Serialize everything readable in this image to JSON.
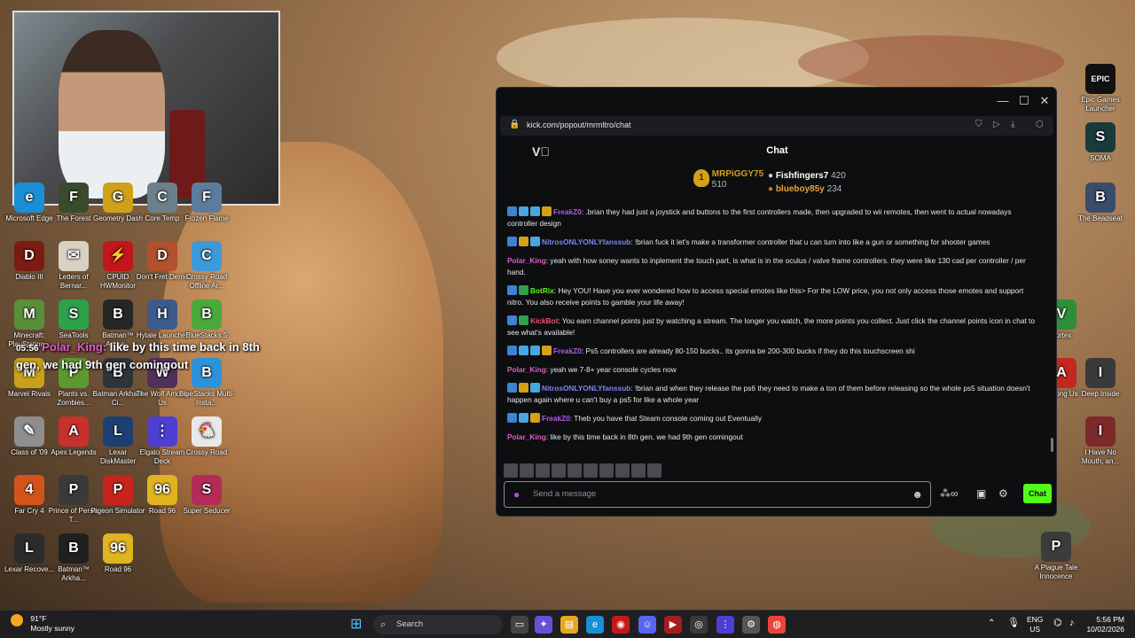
{
  "overlay": {
    "time": "05:56",
    "user": "Polar_King:",
    "text": "like by this time back in 8th gen, we had 9th gen comingout"
  },
  "desktop_left": [
    {
      "label": "Microsoft Edge",
      "icon": "edge-icon",
      "color": "#1a8fd6",
      "glyph": "e"
    },
    {
      "label": "The Forest",
      "icon": "forest-icon",
      "color": "#394b2d",
      "glyph": "F"
    },
    {
      "label": "Geometry Dash",
      "icon": "geometry-dash-icon",
      "color": "#d0a019",
      "glyph": "G"
    },
    {
      "label": "Core Temp",
      "icon": "core-temp-icon",
      "color": "#6b7f8c",
      "glyph": "C"
    },
    {
      "label": "Frozen Flame",
      "icon": "frozen-flame-icon",
      "color": "#5c7c9e",
      "glyph": "F"
    },
    {
      "label": "Diablo III",
      "icon": "diablo-icon",
      "color": "#7a1c12",
      "glyph": "D"
    },
    {
      "label": "Letters of Bernar...",
      "icon": "letters-icon",
      "color": "#d9d2c3",
      "glyph": "✉"
    },
    {
      "label": "CPUID HWMonitor",
      "icon": "hwmonitor-icon",
      "color": "#c3151c",
      "glyph": "⚡"
    },
    {
      "label": "Don't Fret Demo",
      "icon": "dont-fret-icon",
      "color": "#b3502e",
      "glyph": "D"
    },
    {
      "label": "Crossy Road Offline Ar...",
      "icon": "crossy-road-icon",
      "color": "#3d9ad8",
      "glyph": "C"
    },
    {
      "label": "Minecraft: PlayStation...",
      "icon": "minecraft-icon",
      "color": "#5a8f3a",
      "glyph": "M"
    },
    {
      "label": "SeaTools",
      "icon": "seatools-icon",
      "color": "#2fa04c",
      "glyph": "S"
    },
    {
      "label": "Batman™ Arkha...",
      "icon": "batman-icon",
      "color": "#262626",
      "glyph": "B"
    },
    {
      "label": "Hytale Launcher",
      "icon": "hytale-icon",
      "color": "#3c5a8a",
      "glyph": "H"
    },
    {
      "label": "BlueStacks 5",
      "icon": "bluestacks-icon",
      "color": "#4aa83d",
      "glyph": "B"
    },
    {
      "label": "Marvel Rivals",
      "icon": "marvel-icon",
      "color": "#c7a11a",
      "glyph": "M"
    },
    {
      "label": "Plants vs. Zombies...",
      "icon": "pvz-icon",
      "color": "#5c9a2f",
      "glyph": "P"
    },
    {
      "label": "Batman Arkham Ci...",
      "icon": "batman-city-icon",
      "color": "#30343a",
      "glyph": "B"
    },
    {
      "label": "The Wolf Among Us",
      "icon": "wolf-icon",
      "color": "#51305a",
      "glyph": "W"
    },
    {
      "label": "BlueStacks Multi-Insta...",
      "icon": "bluestacks-multi-icon",
      "color": "#2d93d9",
      "glyph": "B"
    },
    {
      "label": "Class of '09",
      "icon": "class09-icon",
      "color": "#8e8e8e",
      "glyph": "✎"
    },
    {
      "label": "Apex Legends",
      "icon": "apex-icon",
      "color": "#c8302c",
      "glyph": "A"
    },
    {
      "label": "Lexar DiskMaster",
      "icon": "lexar-icon",
      "color": "#1d3f73",
      "glyph": "L"
    },
    {
      "label": "Elgato Stream Deck",
      "icon": "elgato-icon",
      "color": "#4c3fd1",
      "glyph": "⋮"
    },
    {
      "label": "Crossy Road",
      "icon": "crossy-road-2-icon",
      "color": "#e8e8e8",
      "glyph": "🐔"
    },
    {
      "label": "Far Cry 4",
      "icon": "farcry-icon",
      "color": "#d2541b",
      "glyph": "4"
    },
    {
      "label": "Prince of Persia T...",
      "icon": "prince-persia-icon",
      "color": "#3a3a3a",
      "glyph": "P"
    },
    {
      "label": "Pigeon Simulator",
      "icon": "pigeon-icon",
      "color": "#c7241e",
      "glyph": "P"
    },
    {
      "label": "Road 96",
      "icon": "road96-icon",
      "color": "#e0b320",
      "glyph": "96"
    },
    {
      "label": "Super Seducer",
      "icon": "seducer-icon",
      "color": "#b32c57",
      "glyph": "S"
    },
    {
      "label": "Lexar Recove...",
      "icon": "lexar-recovery-icon",
      "color": "#2b2b2b",
      "glyph": "L"
    },
    {
      "label": "Batman™ Arkha...",
      "icon": "batman-2-icon",
      "color": "#202020",
      "glyph": "B"
    },
    {
      "label": "Road 96",
      "icon": "road96-2-icon",
      "color": "#e0b320",
      "glyph": "96"
    }
  ],
  "desktop_right": [
    {
      "label": "Epic Games Launcher",
      "icon": "epic-icon",
      "color": "#111",
      "glyph": "EPIC"
    },
    {
      "label": "SOMA",
      "icon": "soma-icon",
      "color": "#1b3a3a",
      "glyph": "S"
    },
    {
      "label": "The Beadseat",
      "icon": "beadseat-icon",
      "color": "#3a4c6b",
      "glyph": "B"
    },
    {
      "label": "Vortex",
      "icon": "vortex-icon",
      "color": "#2c8f3a",
      "glyph": "V"
    },
    {
      "label": "Among Us",
      "icon": "among-us-icon",
      "color": "#c4271f",
      "glyph": "A"
    },
    {
      "label": "Deep Inside",
      "icon": "deep-inside-icon",
      "color": "#3a3a3a",
      "glyph": "I"
    },
    {
      "label": "I Have No Mouth, an...",
      "icon": "no-mouth-icon",
      "color": "#7d2a2a",
      "glyph": "I"
    },
    {
      "label": "A Plague Tale Innocence",
      "icon": "plague-tale-icon",
      "color": "#3c3c3c",
      "glyph": "P"
    }
  ],
  "window": {
    "url": "kick.com/popout/mrmltro/chat",
    "title": "Chat",
    "controls": {
      "minimize": "—",
      "maximize": "☐",
      "close": "✕"
    }
  },
  "leaderboard": {
    "first": {
      "name": "MRPiGGY75",
      "points": "510"
    },
    "second": {
      "name": "Fishfingers7",
      "points": "420"
    },
    "third": {
      "name": "blueboy85y",
      "points": "234"
    }
  },
  "messages": [
    {
      "user": "FreakZ0",
      "color": "#b15ce6",
      "badges": [
        "#3d82d6",
        "#4aa6e0",
        "#4aa6e0",
        "#d4a017"
      ],
      "text": ": .brian they had just a joystick and buttons to the first controllers made, then upgraded to wii remotes, then went to actual nowadays controller design"
    },
    {
      "user": "NitrosONLYONLYfanssub",
      "color": "#7b86f2",
      "badges": [
        "#3d82d6",
        "#d4a017",
        "#4aa6e0"
      ],
      "text": ": !brian fuck it let's make a transformer controller that u can turn into like a gun or something for shooter games"
    },
    {
      "user": "Polar_King",
      "color": "#e05dc7",
      "badges": [],
      "text": ": yeah with how soney wants to inplement the touch part, is what is in the oculus / valve frame controllers. they were like 130 cad per controller / per hand."
    },
    {
      "user": "BotRix",
      "color": "#53fc18",
      "badges": [
        "#3d82d6",
        "#2fa04c"
      ],
      "text": ": Hey YOU! Have you ever wondered how to access special emotes like this> For the LOW price, you not only access those emotes and support nitro. You also receive points to gamble your life away!"
    },
    {
      "user": "KickBot",
      "color": "#f0506e",
      "badges": [
        "#3d82d6",
        "#2fa04c"
      ],
      "text": ": You earn channel points just by watching a stream. The longer you watch, the more points you collect. Just click the channel points icon in chat to see what's available!"
    },
    {
      "user": "FreakZ0",
      "color": "#b15ce6",
      "badges": [
        "#3d82d6",
        "#4aa6e0",
        "#4aa6e0",
        "#d4a017"
      ],
      "text": ": Ps5 controllers are already 80-150 bucks.. its gonna be 200-300 bucks if they do this touchscreen shi"
    },
    {
      "user": "Polar_King",
      "color": "#e05dc7",
      "badges": [],
      "text": ": yeah we 7-8+ year console cycles now"
    },
    {
      "user": "NitrosONLYONLYfanssub",
      "color": "#7b86f2",
      "badges": [
        "#3d82d6",
        "#d4a017",
        "#4aa6e0"
      ],
      "text": ": !brian and when they release the ps6 they need to make a ton of them before releasing so the whole ps5 situation doesn't happen again where u can't buy a ps5 for like a whole year"
    },
    {
      "user": "FreakZ0",
      "color": "#b15ce6",
      "badges": [
        "#3d82d6",
        "#4aa6e0",
        "#d4a017"
      ],
      "text": ": Theb you have that Steam console coming out Eventually"
    },
    {
      "user": "Polar_King",
      "color": "#e05dc7",
      "badges": [],
      "text": ": like by this time back in 8th gen, we had 9th gen comingout"
    }
  ],
  "input": {
    "placeholder": "Send a message",
    "send_label": "Chat"
  },
  "taskbar": {
    "temp": "91°F",
    "weather": "Mostly sunny",
    "search": "Search",
    "lang1": "ENG",
    "lang2": "US",
    "time": "5:56 PM",
    "date": "10/02/2026"
  }
}
